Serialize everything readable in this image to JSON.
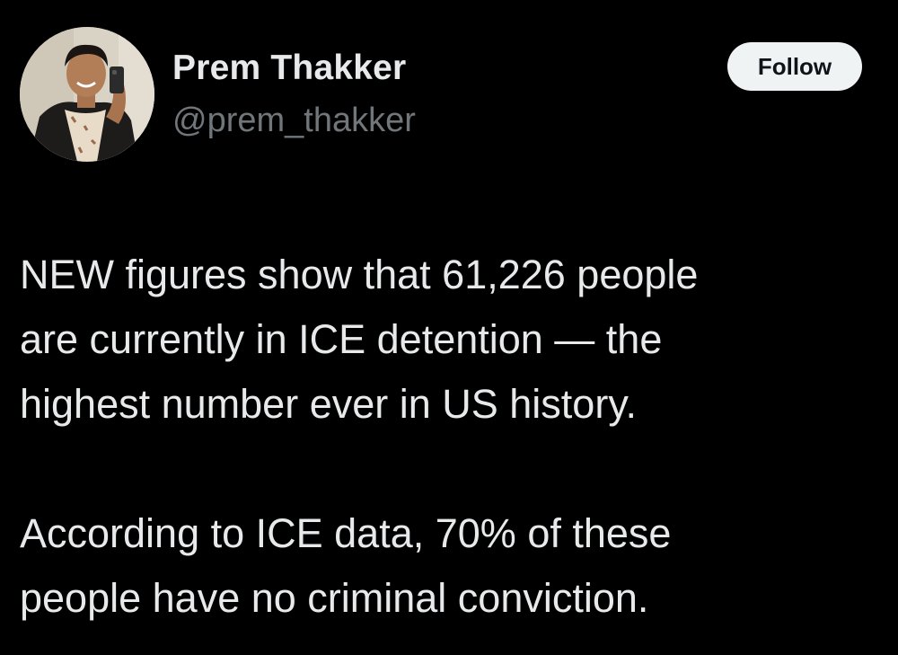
{
  "author": {
    "display_name": "Prem Thakker",
    "handle": "@prem_thakker",
    "avatar_icon": "profile-photo"
  },
  "follow_button": {
    "label": "Follow"
  },
  "tweet": {
    "paragraphs": [
      {
        "lines": [
          "NEW figures show that 61,226 people",
          "are currently in ICE detention — the",
          "highest number ever in US history."
        ]
      },
      {
        "lines": [
          "According to ICE data, 70% of these",
          "people have no criminal conviction."
        ]
      }
    ]
  },
  "colors": {
    "background": "#000000",
    "primary_text": "#e7e9ea",
    "secondary_text": "#71767b",
    "button_bg": "#eff3f4",
    "button_text": "#0f1419"
  }
}
